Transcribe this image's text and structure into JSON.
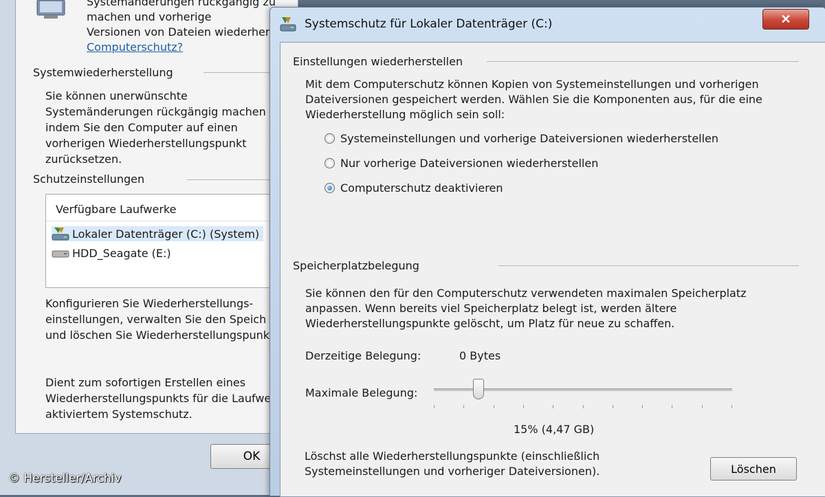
{
  "background_window": {
    "intro_line1": "Systemänderungen rückgängig zu machen und vorherige",
    "intro_line2": "Versionen von Dateien wiederher",
    "link": "Computerschutz?",
    "restore_section": {
      "title": "Systemwiederherstellung",
      "line1": "Sie können unerwünschte",
      "line2": "Systemänderungen rückgängig machen",
      "line3": "indem Sie den Computer auf einen",
      "line4": "vorherigen Wiederherstellungspunkt",
      "line5": "zurücksetzen."
    },
    "protection_section": {
      "title": "Schutzeinstellungen",
      "drives_header": "Verfügbare Laufwerke",
      "drives": [
        {
          "label": "Lokaler Datenträger (C:) (System)"
        },
        {
          "label": "HDD_Seagate (E:)"
        }
      ],
      "configure_line1": "Konfigurieren Sie Wiederherstellungs-",
      "configure_line2": "einstellungen, verwalten Sie den Speich",
      "configure_line3": "und löschen Sie Wiederherstellungspunk",
      "create_line1": "Dient zum sofortigen Erstellen eines",
      "create_line2": "Wiederherstellungspunkts für die Laufwe",
      "create_line3": "aktiviertem Systemschutz."
    },
    "ok_button": "OK"
  },
  "copyright": "© Hersteller/Archiv",
  "dialog": {
    "title": "Systemschutz für Lokaler Datenträger (C:)",
    "close_symbol": "✕",
    "restore_settings": {
      "title": "Einstellungen wiederherstellen",
      "desc_line1": "Mit dem Computerschutz können Kopien von Systemeinstellungen und vorherigen",
      "desc_line2": "Dateiversionen gespeichert werden. Wählen Sie die Komponenten aus, für die eine",
      "desc_line3": "Wiederherstellung möglich sein soll:",
      "options": [
        {
          "label": "Systemeinstellungen und vorherige Dateiversionen wiederherstellen",
          "checked": false
        },
        {
          "label": "Nur vorherige Dateiversionen wiederherstellen",
          "checked": false
        },
        {
          "label": "Computerschutz deaktivieren",
          "checked": true
        }
      ]
    },
    "disk_usage": {
      "title": "Speicherplatzbelegung",
      "desc_line1": "Sie können den für den Computerschutz verwendeten maximalen Speicherplatz",
      "desc_line2": "anpassen. Wenn bereits viel Speicherplatz belegt ist, werden ältere",
      "desc_line3": "Wiederherstellungspunkte gelöscht, um Platz für neue zu schaffen.",
      "current_label": "Derzeitige Belegung:",
      "current_value": "0 Bytes",
      "max_label": "Maximale Belegung:",
      "slider_fraction": 0.15,
      "slider_value": "15% (4,47 GB)",
      "delete_line1": "Löschst alle Wiederherstellungspunkte (einschließlich",
      "delete_line2": "Systemeinstellungen und vorheriger Dateiversionen).",
      "delete_button": "Löschen"
    }
  },
  "colors": {
    "title_bar": "#c4d6eb",
    "close_button": "#c8483a",
    "link": "#1f5fa8",
    "radio_dot": "#1f63c2"
  }
}
